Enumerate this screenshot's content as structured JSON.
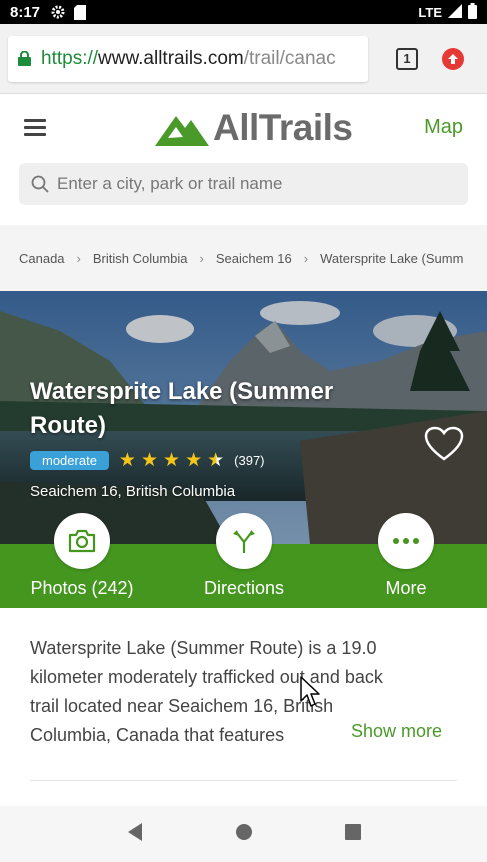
{
  "status_bar": {
    "time": "8:17",
    "network": "LTE"
  },
  "browser": {
    "url_protocol": "https://",
    "url_host": "www.alltrails.com",
    "url_path": "/trail/canac",
    "tab_count": "1"
  },
  "header": {
    "logo_text": "AllTrails",
    "map_label": "Map"
  },
  "search": {
    "placeholder": "Enter a city, park or trail name"
  },
  "breadcrumbs": [
    "Canada",
    "British Columbia",
    "Seaichem 16",
    "Watersprite Lake (Summ"
  ],
  "trail": {
    "title": "Watersprite Lake (Summer Route)",
    "difficulty": "moderate",
    "rating": 4.5,
    "reviews": "(397)",
    "location": "Seaichem 16, British Columbia"
  },
  "actions": [
    {
      "label": "Photos (242)",
      "icon": "camera-icon"
    },
    {
      "label": "Directions",
      "icon": "directions-icon"
    },
    {
      "label": "More",
      "icon": "more-icon"
    }
  ],
  "description": {
    "lines": [
      "Watersprite Lake (Summer Route) is a 19.0",
      "kilometer moderately trafficked out and back",
      "trail located near Seaichem 16, British",
      "Columbia, Canada that features"
    ],
    "show_more": "Show more"
  },
  "colors": {
    "brand_green": "#44961f",
    "badge_blue": "#3aa0d8",
    "star_yellow": "#f5c518"
  }
}
